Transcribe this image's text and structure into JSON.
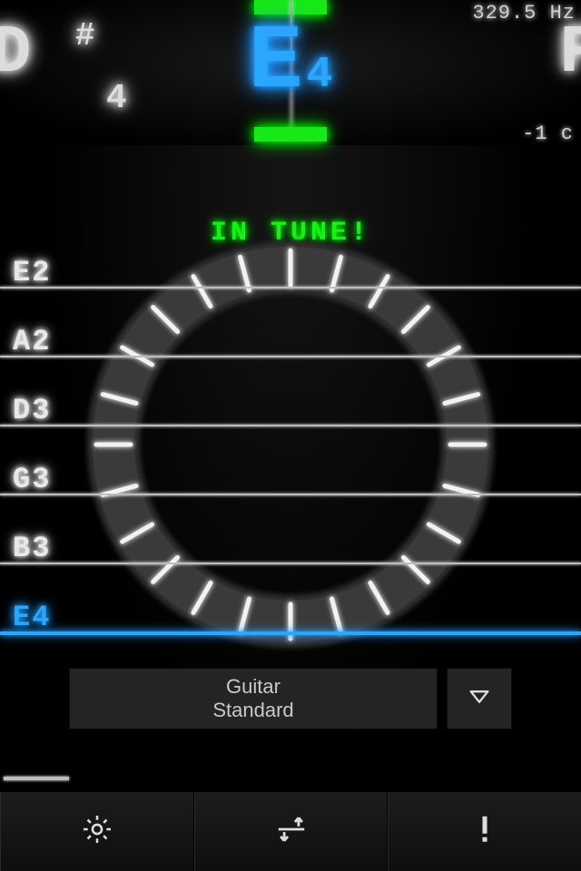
{
  "header": {
    "frequency": "329.5 Hz",
    "cents": "-1 c",
    "prev_note_letter": "D",
    "prev_note_accidental": "#",
    "prev_note_octave": "4",
    "current_letter": "E",
    "current_octave": "4",
    "next_note_letter": "F"
  },
  "status_text": "IN TUNE!",
  "strings": [
    {
      "label": "E2",
      "active": false
    },
    {
      "label": "A2",
      "active": false
    },
    {
      "label": "D3",
      "active": false
    },
    {
      "label": "G3",
      "active": false
    },
    {
      "label": "B3",
      "active": false
    },
    {
      "label": "E4",
      "active": true
    }
  ],
  "instrument": {
    "line1": "Guitar",
    "line2": "Standard"
  },
  "icons": {
    "settings": "gear",
    "tuning": "arrows",
    "info": "exclaim",
    "dropdown": "triangle-down"
  }
}
